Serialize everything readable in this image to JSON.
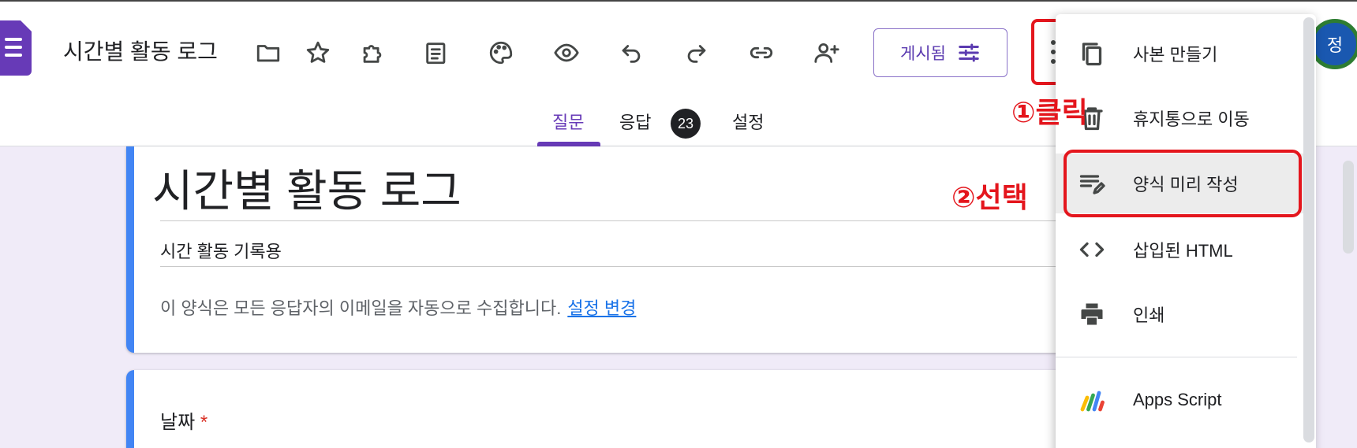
{
  "header": {
    "doc_title": "시간별 활동 로그",
    "toolbar_icons": [
      "folder-icon",
      "star-icon",
      "addon-icon",
      "customize-icon",
      "palette-icon",
      "preview-icon",
      "undo-icon",
      "redo-icon",
      "link-icon",
      "add-collaborator-icon"
    ],
    "publish_label": "게시됨",
    "avatar_initial": "정"
  },
  "tabs": {
    "questions": "질문",
    "responses": "응답",
    "responses_count": "23",
    "settings": "설정"
  },
  "form": {
    "title": "시간별 활동 로그",
    "description": "시간 활동 기록용",
    "notice": "이 양식은 모든 응답자의 이메일을 자동으로 수집합니다.",
    "notice_link": "설정 변경",
    "question1_label": "날짜",
    "required_mark": "*"
  },
  "annotations": {
    "step1": "①클릭",
    "step2": "②선택"
  },
  "menu": {
    "items": [
      {
        "label": "사본 만들기",
        "icon": "copy-icon"
      },
      {
        "label": "휴지통으로 이동",
        "icon": "trash-icon"
      },
      {
        "label": "양식 미리 작성",
        "icon": "prefill-icon"
      },
      {
        "label": "삽입된 HTML",
        "icon": "code-icon"
      },
      {
        "label": "인쇄",
        "icon": "print-icon"
      },
      {
        "label": "Apps Script",
        "icon": "apps-script-icon"
      }
    ]
  },
  "colors": {
    "accent": "#673ab7",
    "annotation": "#e4161d",
    "card_stripe": "#4285f4",
    "background": "#f0ebf8"
  }
}
